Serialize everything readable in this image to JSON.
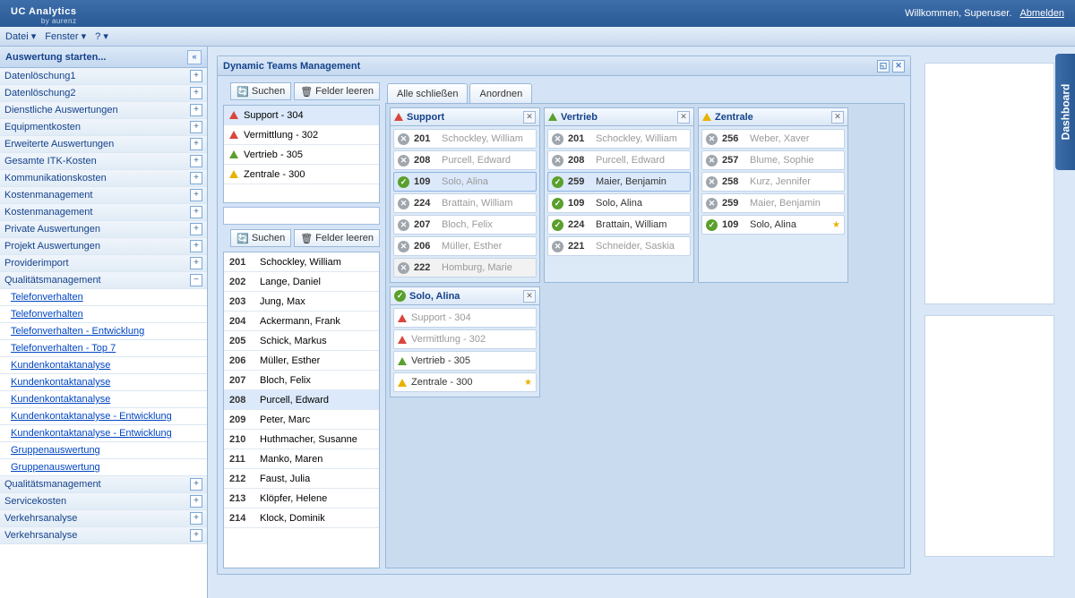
{
  "header": {
    "brand": "UC Analytics",
    "sub": "by aurenz",
    "welcome": "Willkommen, Superuser.",
    "logout": "Abmelden"
  },
  "menu": {
    "file": "Datei ▾",
    "window": "Fenster ▾",
    "help": "? ▾"
  },
  "sidebar": {
    "title": "Auswertung starten...",
    "items": [
      {
        "label": "Datenlöschung1",
        "type": "node",
        "pm": "+"
      },
      {
        "label": "Datenlöschung2",
        "type": "node",
        "pm": "+"
      },
      {
        "label": "Dienstliche Auswertungen",
        "type": "node",
        "pm": "+"
      },
      {
        "label": "Equipmentkosten",
        "type": "node",
        "pm": "+"
      },
      {
        "label": "Erweiterte Auswertungen",
        "type": "node",
        "pm": "+"
      },
      {
        "label": "Gesamte ITK-Kosten",
        "type": "node",
        "pm": "+"
      },
      {
        "label": "Kommunikationskosten",
        "type": "node",
        "pm": "+"
      },
      {
        "label": "Kostenmanagement",
        "type": "node",
        "pm": "+"
      },
      {
        "label": "Kostenmanagement",
        "type": "node",
        "pm": "+"
      },
      {
        "label": "Private Auswertungen",
        "type": "node",
        "pm": "+"
      },
      {
        "label": "Projekt Auswertungen",
        "type": "node",
        "pm": "+"
      },
      {
        "label": "Providerimport",
        "type": "node",
        "pm": "+"
      },
      {
        "label": "Qualitätsmanagement",
        "type": "node",
        "pm": "−"
      },
      {
        "label": "Telefonverhalten",
        "type": "link"
      },
      {
        "label": "Telefonverhalten",
        "type": "link"
      },
      {
        "label": "Telefonverhalten - Entwicklung",
        "type": "link"
      },
      {
        "label": "Telefonverhalten - Top 7",
        "type": "link"
      },
      {
        "label": "Kundenkontaktanalyse",
        "type": "link"
      },
      {
        "label": "Kundenkontaktanalyse",
        "type": "link"
      },
      {
        "label": "Kundenkontaktanalyse",
        "type": "link"
      },
      {
        "label": "Kundenkontaktanalyse - Entwicklung",
        "type": "link"
      },
      {
        "label": "Kundenkontaktanalyse - Entwicklung",
        "type": "link"
      },
      {
        "label": "Gruppenauswertung",
        "type": "link"
      },
      {
        "label": "Gruppenauswertung",
        "type": "link"
      },
      {
        "label": "Qualitätsmanagement",
        "type": "node",
        "pm": "+"
      },
      {
        "label": "Servicekosten",
        "type": "node",
        "pm": "+"
      },
      {
        "label": "Verkehrsanalyse",
        "type": "node",
        "pm": "+"
      },
      {
        "label": "Verkehrsanalyse",
        "type": "node",
        "pm": "+"
      }
    ]
  },
  "dtm": {
    "title": "Dynamic Teams Management",
    "search": "Suchen",
    "clear": "Felder leeren",
    "groups": [
      {
        "icon": "red",
        "label": "Support - 304",
        "sel": true
      },
      {
        "icon": "red",
        "label": "Vermittlung - 302"
      },
      {
        "icon": "green",
        "label": "Vertrieb - 305"
      },
      {
        "icon": "yellow",
        "label": "Zentrale - 300"
      }
    ],
    "people": [
      {
        "num": "201",
        "name": "Schockley, William"
      },
      {
        "num": "202",
        "name": "Lange, Daniel"
      },
      {
        "num": "203",
        "name": "Jung, Max"
      },
      {
        "num": "204",
        "name": "Ackermann, Frank"
      },
      {
        "num": "205",
        "name": "Schick, Markus"
      },
      {
        "num": "206",
        "name": "Müller, Esther"
      },
      {
        "num": "207",
        "name": "Bloch, Felix"
      },
      {
        "num": "208",
        "name": "Purcell, Edward",
        "sel": true
      },
      {
        "num": "209",
        "name": "Peter, Marc"
      },
      {
        "num": "210",
        "name": "Huthmacher, Susanne"
      },
      {
        "num": "211",
        "name": "Manko, Maren"
      },
      {
        "num": "212",
        "name": "Faust, Julia"
      },
      {
        "num": "213",
        "name": "Klöpfer, Helene"
      },
      {
        "num": "214",
        "name": "Klock, Dominik"
      }
    ],
    "tabs": {
      "closeAll": "Alle schließen",
      "arrange": "Anordnen"
    },
    "panels": [
      {
        "title": "Support",
        "icon": "red",
        "rows": [
          {
            "s": "gray",
            "num": "201",
            "name": "Schockley, William",
            "dim": true
          },
          {
            "s": "gray",
            "num": "208",
            "name": "Purcell, Edward",
            "dim": true
          },
          {
            "s": "green",
            "num": "109",
            "name": "Solo, Alina",
            "dim": true,
            "sel": true
          },
          {
            "s": "gray",
            "num": "224",
            "name": "Brattain, William",
            "dim": true
          },
          {
            "s": "gray",
            "num": "207",
            "name": "Bloch, Felix",
            "dim": true
          },
          {
            "s": "gray",
            "num": "206",
            "name": "Müller, Esther",
            "dim": true
          },
          {
            "s": "gray",
            "num": "222",
            "name": "Homburg, Marie",
            "dim": true,
            "dis": true
          }
        ]
      },
      {
        "title": "Vertrieb",
        "icon": "green",
        "rows": [
          {
            "s": "gray",
            "num": "201",
            "name": "Schockley, William",
            "dim": true
          },
          {
            "s": "gray",
            "num": "208",
            "name": "Purcell, Edward",
            "dim": true
          },
          {
            "s": "green",
            "num": "259",
            "name": "Maier, Benjamin",
            "sel": true
          },
          {
            "s": "green",
            "num": "109",
            "name": "Solo, Alina"
          },
          {
            "s": "green",
            "num": "224",
            "name": "Brattain, William"
          },
          {
            "s": "gray",
            "num": "221",
            "name": "Schneider, Saskia",
            "dim": true
          }
        ]
      },
      {
        "title": "Zentrale",
        "icon": "yellow",
        "rows": [
          {
            "s": "gray",
            "num": "256",
            "name": "Weber, Xaver",
            "dim": true
          },
          {
            "s": "gray",
            "num": "257",
            "name": "Blume, Sophie",
            "dim": true
          },
          {
            "s": "gray",
            "num": "258",
            "name": "Kurz, Jennifer",
            "dim": true
          },
          {
            "s": "gray",
            "num": "259",
            "name": "Maier, Benjamin",
            "dim": true
          },
          {
            "s": "green",
            "num": "109",
            "name": "Solo, Alina",
            "star": true
          }
        ]
      },
      {
        "title": "Solo, Alina",
        "icon": "greenCheck",
        "rows": [
          {
            "tri": "red",
            "label": "Support - 304",
            "dim": true
          },
          {
            "tri": "red",
            "label": "Vermittlung - 302",
            "dim": true
          },
          {
            "tri": "green",
            "label": "Vertrieb - 305"
          },
          {
            "tri": "yellow",
            "label": "Zentrale - 300",
            "star": true
          }
        ]
      }
    ]
  },
  "dashboard": "Dashboard"
}
